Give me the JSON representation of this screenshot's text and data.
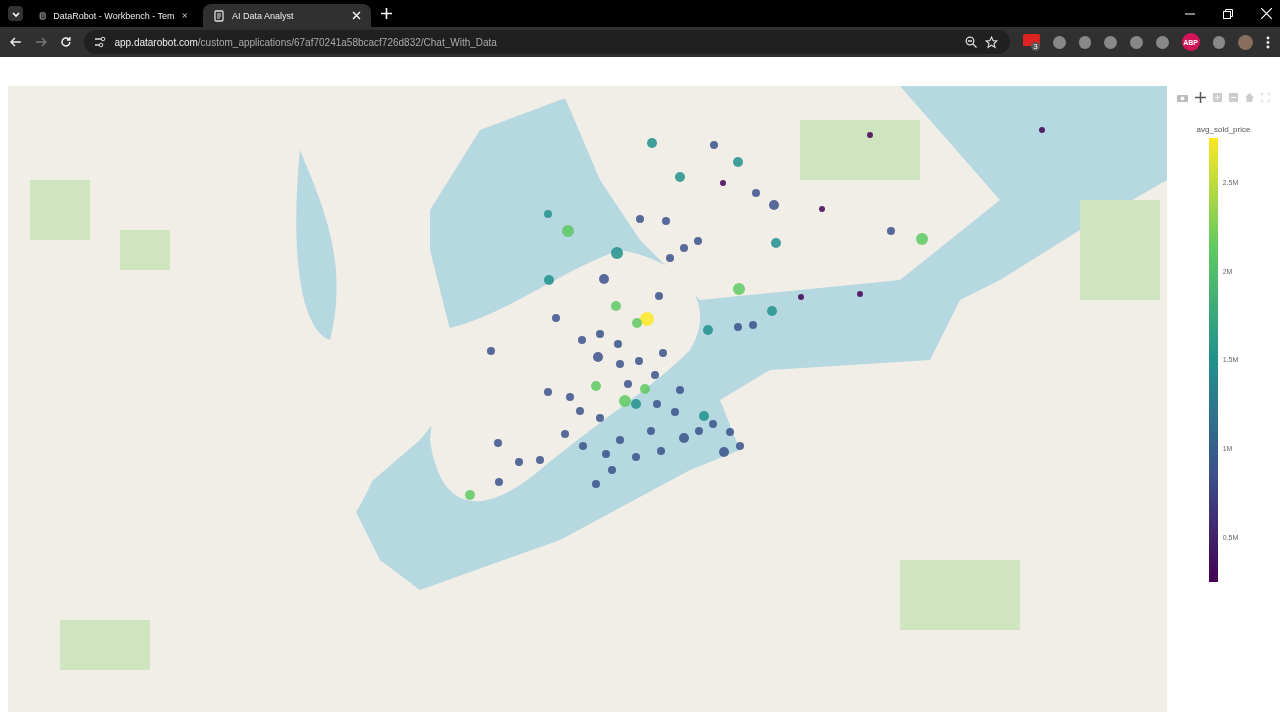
{
  "browser": {
    "tabs": [
      {
        "title": "DataRobot - Workbench - Tem",
        "selected": false
      },
      {
        "title": "AI Data Analyst",
        "selected": true
      }
    ],
    "address": {
      "host": "app.datarobot.com",
      "path": "/custom_applications/67af70241a58bcacf726d832/Chat_With_Data"
    },
    "extensions": [
      {
        "kind": "badge",
        "label": "3"
      },
      {
        "kind": "plain"
      },
      {
        "kind": "plain"
      },
      {
        "kind": "plain"
      },
      {
        "kind": "plain"
      },
      {
        "kind": "plain"
      },
      {
        "kind": "abp",
        "label": "ABP"
      },
      {
        "kind": "plain"
      }
    ]
  },
  "colorbar": {
    "title": "avg_sold_price",
    "ticks": [
      "2.5M",
      "2M",
      "1.5M",
      "1M",
      "0.5M"
    ]
  }
}
